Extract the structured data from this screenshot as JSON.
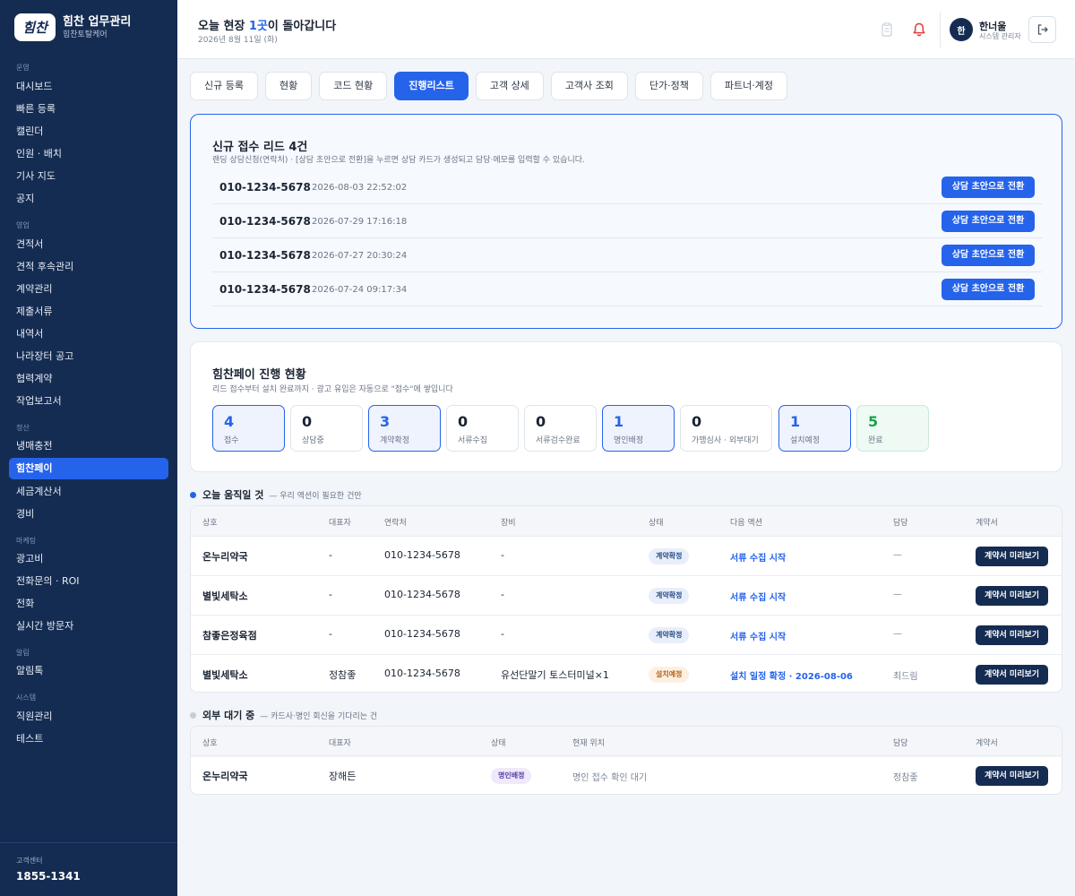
{
  "brand": {
    "logo": "힘찬",
    "title": "힘찬 업무관리",
    "sub": "힘찬토탈케어"
  },
  "sidebar": {
    "sections": {
      "ops": "운영",
      "sales": "영업",
      "settle": "정산",
      "mkt": "마케팅",
      "alarm": "알림",
      "system": "시스템"
    },
    "items": {
      "dashboard": "대시보드",
      "quick": "빠른 등록",
      "calendar": "캘린더",
      "staff": "인원 · 배치",
      "driver_map": "기사 지도",
      "notice": "공지",
      "estimate": "견적서",
      "estimate_follow": "견적 후속관리",
      "contract_mgmt": "계약관리",
      "docs": "제출서류",
      "statement": "내역서",
      "g2b": "나라장터 공고",
      "partner_contract": "협력계약",
      "report": "작업보고서",
      "cooling": "냉매충전",
      "pay": "힘찬페이",
      "tax": "세금계산서",
      "expense": "경비",
      "ad": "광고비",
      "call_roi": "전화문의 · ROI",
      "phone": "전화",
      "visitors": "실시간 방문자",
      "alimtalk": "알림톡",
      "employees": "직원관리",
      "test": "테스트"
    },
    "cs_label": "고객센터",
    "cs_phone": "1855-1341"
  },
  "header": {
    "greeting_pre": "오늘 현장 ",
    "greeting_count": "1곳",
    "greeting_post": "이 돌아갑니다",
    "date": "2026년 8월 11일 (화)",
    "user_initial": "한",
    "user_name": "한너울",
    "user_role": "시스템 관리자"
  },
  "tabs": [
    "신규 등록",
    "현황",
    "코드 현황",
    "진행리스트",
    "고객 상세",
    "고객사 조회",
    "단가·정책",
    "파트너·계정"
  ],
  "leads": {
    "title": "신규 접수 리드 4건",
    "desc": "랜딩 상담신청(연락처) · [상담 초안으로 전환]을 누르면 상담 카드가 생성되고 담당·메모를 입력할 수 있습니다.",
    "button": "상담 초안으로 전환",
    "rows": [
      {
        "phone": "010-1234-5678",
        "time": "2026-08-03 22:52:02"
      },
      {
        "phone": "010-1234-5678",
        "time": "2026-07-29 17:16:18"
      },
      {
        "phone": "010-1234-5678",
        "time": "2026-07-27 20:30:24"
      },
      {
        "phone": "010-1234-5678",
        "time": "2026-07-24 09:17:34"
      }
    ]
  },
  "pay": {
    "title": "힘찬페이 진행 현황",
    "desc": "리드 접수부터 설치 완료까지 · 광고 유입은 자동으로 \"접수\"에 쌓입니다",
    "stats": [
      {
        "num": "4",
        "label": "접수"
      },
      {
        "num": "0",
        "label": "상담중"
      },
      {
        "num": "3",
        "label": "계약확정"
      },
      {
        "num": "0",
        "label": "서류수집"
      },
      {
        "num": "0",
        "label": "서류검수완료"
      },
      {
        "num": "1",
        "label": "명인배정"
      },
      {
        "num": "0",
        "label": "가맹심사 · 외부대기"
      },
      {
        "num": "1",
        "label": "설치예정"
      },
      {
        "num": "5",
        "label": "완료"
      }
    ]
  },
  "today": {
    "title": "오늘 움직일 것",
    "desc": "— 우리 액션이 필요한 건만",
    "headers": {
      "shop": "상호",
      "ceo": "대표자",
      "contact": "연락처",
      "device": "장비",
      "status": "상태",
      "next": "다음 액션",
      "owner": "담당",
      "contract": "계약서"
    },
    "button": "계약서 미리보기",
    "rows": [
      {
        "shop": "온누리약국",
        "ceo": "-",
        "contact": "010-1234-5678",
        "device": "-",
        "status": "계약확정",
        "next": "서류 수집 시작",
        "owner": "—"
      },
      {
        "shop": "별빛세탁소",
        "ceo": "-",
        "contact": "010-1234-5678",
        "device": "-",
        "status": "계약확정",
        "next": "서류 수집 시작",
        "owner": "—"
      },
      {
        "shop": "참좋은정육점",
        "ceo": "-",
        "contact": "010-1234-5678",
        "device": "-",
        "status": "계약확정",
        "next": "서류 수집 시작",
        "owner": "—"
      },
      {
        "shop": "별빛세탁소",
        "ceo": "정참좋",
        "contact": "010-1234-5678",
        "device": "유선단말기 토스터미널×1",
        "status": "설치예정",
        "next": "설치 일정 확정 · 2026-08-06",
        "owner": "최드림"
      }
    ]
  },
  "waiting": {
    "title": "외부 대기 중",
    "desc": "— 카드사·명인 회신을 기다리는 건",
    "headers": {
      "shop": "상호",
      "ceo": "대표자",
      "status": "상태",
      "location": "현재 위치",
      "owner": "담당",
      "contract": "계약서"
    },
    "button": "계약서 미리보기",
    "rows": [
      {
        "shop": "온누리약국",
        "ceo": "장해든",
        "status": "명인배정",
        "location": "명인 접수 확인 대기",
        "owner": "정참좋"
      }
    ]
  }
}
